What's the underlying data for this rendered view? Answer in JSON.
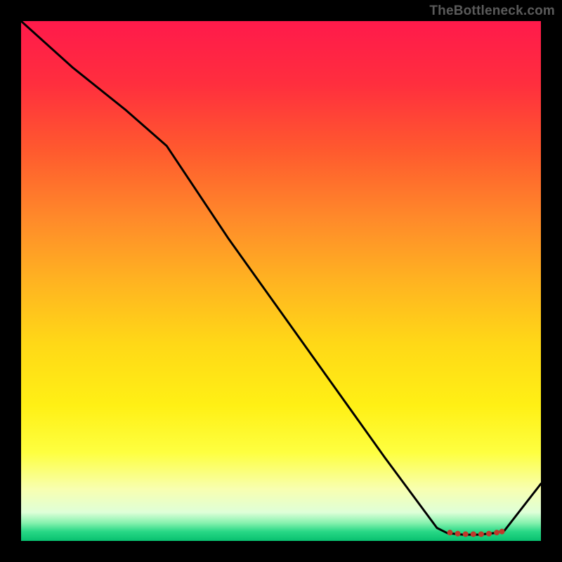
{
  "watermark": "TheBottleneck.com",
  "chart_data": {
    "type": "line",
    "title": "",
    "xlabel": "",
    "ylabel": "",
    "xlim": [
      0,
      100
    ],
    "ylim": [
      0,
      100
    ],
    "series": [
      {
        "name": "curve",
        "x": [
          0,
          10,
          20,
          28,
          40,
          50,
          60,
          70,
          80,
          82,
          85,
          88,
          91,
          93,
          100
        ],
        "y": [
          100,
          91,
          83,
          76,
          58,
          44,
          30,
          16,
          2.5,
          1.5,
          1.2,
          1.2,
          1.5,
          2,
          11
        ]
      }
    ],
    "markers": {
      "name": "dots",
      "x": [
        82.5,
        84,
        85.5,
        87,
        88.5,
        90,
        91.5,
        92.5
      ],
      "y": [
        1.6,
        1.4,
        1.3,
        1.3,
        1.3,
        1.4,
        1.6,
        1.8
      ]
    },
    "gradient_stops": [
      {
        "offset": 0.0,
        "color": "#ff1a4b"
      },
      {
        "offset": 0.12,
        "color": "#ff2e3e"
      },
      {
        "offset": 0.25,
        "color": "#ff5a2e"
      },
      {
        "offset": 0.38,
        "color": "#ff8a2a"
      },
      {
        "offset": 0.5,
        "color": "#ffb321"
      },
      {
        "offset": 0.62,
        "color": "#ffd817"
      },
      {
        "offset": 0.74,
        "color": "#fff015"
      },
      {
        "offset": 0.83,
        "color": "#feff40"
      },
      {
        "offset": 0.9,
        "color": "#f8ffb0"
      },
      {
        "offset": 0.945,
        "color": "#dfffd8"
      },
      {
        "offset": 0.965,
        "color": "#88f2af"
      },
      {
        "offset": 0.982,
        "color": "#28d886"
      },
      {
        "offset": 1.0,
        "color": "#08c06f"
      }
    ]
  }
}
